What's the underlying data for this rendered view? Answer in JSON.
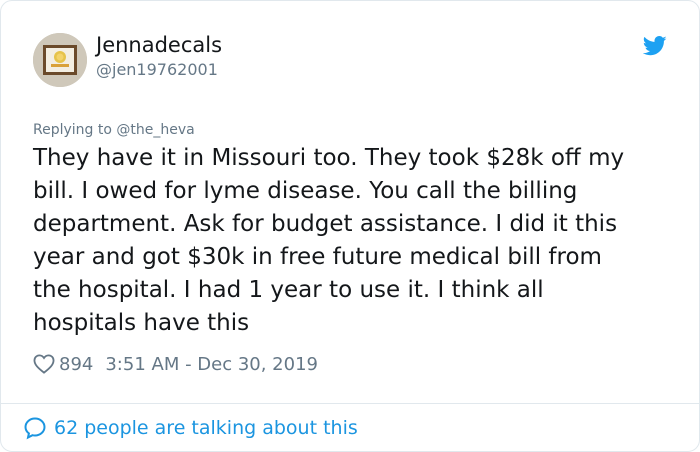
{
  "tweet": {
    "author": {
      "display_name": "Jennadecals",
      "handle": "@jen19762001",
      "avatar_icon": "framed-decal-avatar"
    },
    "brand_icon": "twitter-bird-icon",
    "brand_color": "#1da1f2",
    "reply_context": {
      "prefix": "Replying to",
      "mention": "@the_heva"
    },
    "text": "They have it in Missouri too. They took $28k off my\nbill. I owed for lyme disease. You call the billing\ndepartment.  Ask for budget assistance.  I did it this\nyear and got $30k in free future medical bill from\nthe hospital. I had 1 year to use it. I think all\nhospitals have this",
    "likes": "894",
    "timestamp": "3:51 AM - Dec 30, 2019",
    "talking_label": "62 people are talking about this",
    "colors": {
      "text": "#14171a",
      "secondary": "#657786",
      "link": "#1b95e0",
      "border": "#e1e8ed"
    }
  }
}
